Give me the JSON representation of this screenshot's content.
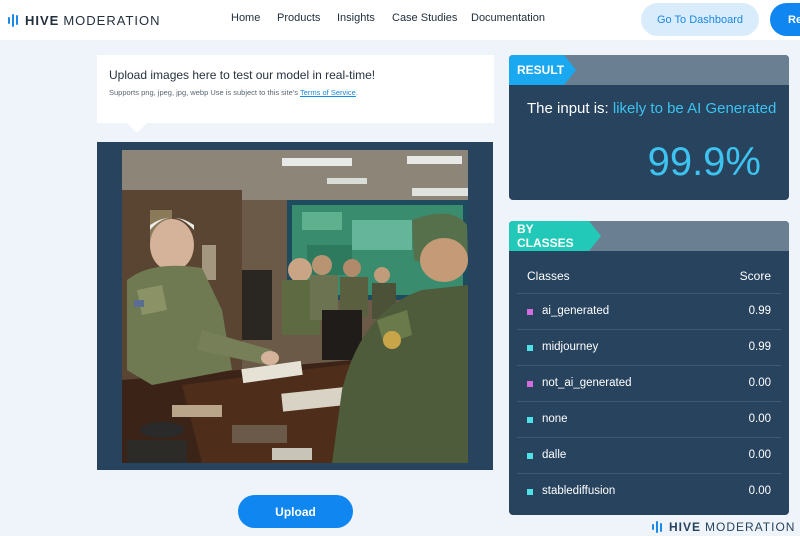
{
  "brand": {
    "bold": "HIVE",
    "light": "MODERATION"
  },
  "nav": {
    "links": [
      "Home",
      "Products",
      "Insights",
      "Case Studies",
      "Documentation"
    ],
    "dashboard_button": "Go To Dashboard",
    "right_button": "Re"
  },
  "upload": {
    "title": "Upload images here to test our model in real-time!",
    "subtitle": "Supports png, jpeg, jpg, webp Use is subject to this site's",
    "terms_link": "Terms of Service",
    "button": "Upload"
  },
  "result": {
    "tag": "RESULT",
    "prefix": "The input is:",
    "verdict": "likely to be AI Generated",
    "percent": "99.9%"
  },
  "by_classes": {
    "tag": "BY CLASSES",
    "col_class": "Classes",
    "col_score": "Score",
    "rows": [
      {
        "name": "ai_generated",
        "score": "0.99",
        "color": "#d46ce0"
      },
      {
        "name": "midjourney",
        "score": "0.99",
        "color": "#4fe0e8"
      },
      {
        "name": "not_ai_generated",
        "score": "0.00",
        "color": "#d46ce0"
      },
      {
        "name": "none",
        "score": "0.00",
        "color": "#4fe0e8"
      },
      {
        "name": "dalle",
        "score": "0.00",
        "color": "#4fe0e8"
      },
      {
        "name": "stablediffusion",
        "score": "0.00",
        "color": "#4fe0e8"
      }
    ]
  },
  "colors": {
    "accent": "#0f86f0",
    "panel": "#27435e",
    "highlight": "#3cc3f0",
    "classes_tag": "#23c9b8"
  }
}
